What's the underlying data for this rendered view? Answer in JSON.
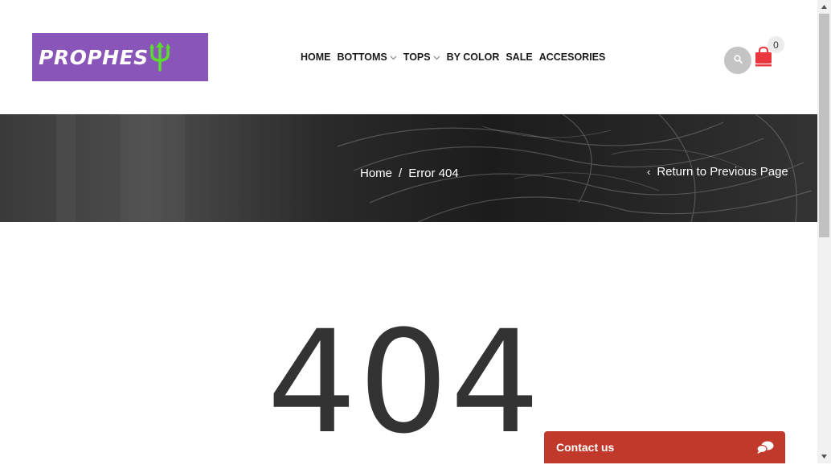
{
  "brand": {
    "logo_text": "PROPHES",
    "logo_bg": "#8a55b8",
    "trident_color": "#5adc2e"
  },
  "nav": [
    {
      "label": "HOME",
      "has_dropdown": false
    },
    {
      "label": "BOTTOMS",
      "has_dropdown": true
    },
    {
      "label": "TOPS",
      "has_dropdown": true
    },
    {
      "label": "BY COLOR",
      "has_dropdown": false
    },
    {
      "label": "SALE",
      "has_dropdown": false
    },
    {
      "label": "ACCESORIES",
      "has_dropdown": false
    }
  ],
  "header_icons": {
    "search": "search-icon",
    "cart": "shopping-bag-icon",
    "cart_count": "0",
    "cart_color": "#e8373e"
  },
  "breadcrumb": {
    "home": "Home",
    "separator": "/",
    "current": "Error 404"
  },
  "return_link": {
    "arrow": "‹",
    "label": "Return to Previous Page"
  },
  "error_code": "404",
  "contact": {
    "label": "Contact us",
    "icon": "chat-bubbles-icon",
    "color": "#c0392b"
  }
}
